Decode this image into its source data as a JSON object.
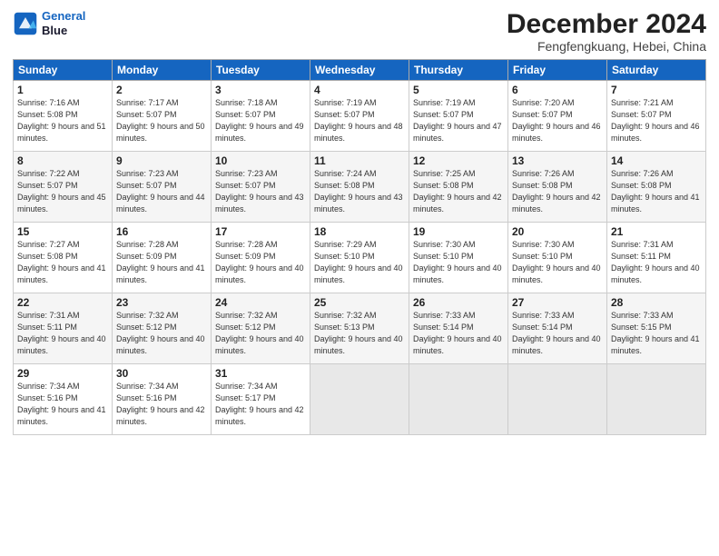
{
  "header": {
    "logo_line1": "General",
    "logo_line2": "Blue",
    "month": "December 2024",
    "location": "Fengfengkuang, Hebei, China"
  },
  "weekdays": [
    "Sunday",
    "Monday",
    "Tuesday",
    "Wednesday",
    "Thursday",
    "Friday",
    "Saturday"
  ],
  "weeks": [
    [
      {
        "day": "1",
        "info": "Sunrise: 7:16 AM\nSunset: 5:08 PM\nDaylight: 9 hours\nand 51 minutes."
      },
      {
        "day": "2",
        "info": "Sunrise: 7:17 AM\nSunset: 5:07 PM\nDaylight: 9 hours\nand 50 minutes."
      },
      {
        "day": "3",
        "info": "Sunrise: 7:18 AM\nSunset: 5:07 PM\nDaylight: 9 hours\nand 49 minutes."
      },
      {
        "day": "4",
        "info": "Sunrise: 7:19 AM\nSunset: 5:07 PM\nDaylight: 9 hours\nand 48 minutes."
      },
      {
        "day": "5",
        "info": "Sunrise: 7:19 AM\nSunset: 5:07 PM\nDaylight: 9 hours\nand 47 minutes."
      },
      {
        "day": "6",
        "info": "Sunrise: 7:20 AM\nSunset: 5:07 PM\nDaylight: 9 hours\nand 46 minutes."
      },
      {
        "day": "7",
        "info": "Sunrise: 7:21 AM\nSunset: 5:07 PM\nDaylight: 9 hours\nand 46 minutes."
      }
    ],
    [
      {
        "day": "8",
        "info": "Sunrise: 7:22 AM\nSunset: 5:07 PM\nDaylight: 9 hours\nand 45 minutes."
      },
      {
        "day": "9",
        "info": "Sunrise: 7:23 AM\nSunset: 5:07 PM\nDaylight: 9 hours\nand 44 minutes."
      },
      {
        "day": "10",
        "info": "Sunrise: 7:23 AM\nSunset: 5:07 PM\nDaylight: 9 hours\nand 43 minutes."
      },
      {
        "day": "11",
        "info": "Sunrise: 7:24 AM\nSunset: 5:08 PM\nDaylight: 9 hours\nand 43 minutes."
      },
      {
        "day": "12",
        "info": "Sunrise: 7:25 AM\nSunset: 5:08 PM\nDaylight: 9 hours\nand 42 minutes."
      },
      {
        "day": "13",
        "info": "Sunrise: 7:26 AM\nSunset: 5:08 PM\nDaylight: 9 hours\nand 42 minutes."
      },
      {
        "day": "14",
        "info": "Sunrise: 7:26 AM\nSunset: 5:08 PM\nDaylight: 9 hours\nand 41 minutes."
      }
    ],
    [
      {
        "day": "15",
        "info": "Sunrise: 7:27 AM\nSunset: 5:08 PM\nDaylight: 9 hours\nand 41 minutes."
      },
      {
        "day": "16",
        "info": "Sunrise: 7:28 AM\nSunset: 5:09 PM\nDaylight: 9 hours\nand 41 minutes."
      },
      {
        "day": "17",
        "info": "Sunrise: 7:28 AM\nSunset: 5:09 PM\nDaylight: 9 hours\nand 40 minutes."
      },
      {
        "day": "18",
        "info": "Sunrise: 7:29 AM\nSunset: 5:10 PM\nDaylight: 9 hours\nand 40 minutes."
      },
      {
        "day": "19",
        "info": "Sunrise: 7:30 AM\nSunset: 5:10 PM\nDaylight: 9 hours\nand 40 minutes."
      },
      {
        "day": "20",
        "info": "Sunrise: 7:30 AM\nSunset: 5:10 PM\nDaylight: 9 hours\nand 40 minutes."
      },
      {
        "day": "21",
        "info": "Sunrise: 7:31 AM\nSunset: 5:11 PM\nDaylight: 9 hours\nand 40 minutes."
      }
    ],
    [
      {
        "day": "22",
        "info": "Sunrise: 7:31 AM\nSunset: 5:11 PM\nDaylight: 9 hours\nand 40 minutes."
      },
      {
        "day": "23",
        "info": "Sunrise: 7:32 AM\nSunset: 5:12 PM\nDaylight: 9 hours\nand 40 minutes."
      },
      {
        "day": "24",
        "info": "Sunrise: 7:32 AM\nSunset: 5:12 PM\nDaylight: 9 hours\nand 40 minutes."
      },
      {
        "day": "25",
        "info": "Sunrise: 7:32 AM\nSunset: 5:13 PM\nDaylight: 9 hours\nand 40 minutes."
      },
      {
        "day": "26",
        "info": "Sunrise: 7:33 AM\nSunset: 5:14 PM\nDaylight: 9 hours\nand 40 minutes."
      },
      {
        "day": "27",
        "info": "Sunrise: 7:33 AM\nSunset: 5:14 PM\nDaylight: 9 hours\nand 40 minutes."
      },
      {
        "day": "28",
        "info": "Sunrise: 7:33 AM\nSunset: 5:15 PM\nDaylight: 9 hours\nand 41 minutes."
      }
    ],
    [
      {
        "day": "29",
        "info": "Sunrise: 7:34 AM\nSunset: 5:16 PM\nDaylight: 9 hours\nand 41 minutes."
      },
      {
        "day": "30",
        "info": "Sunrise: 7:34 AM\nSunset: 5:16 PM\nDaylight: 9 hours\nand 42 minutes."
      },
      {
        "day": "31",
        "info": "Sunrise: 7:34 AM\nSunset: 5:17 PM\nDaylight: 9 hours\nand 42 minutes."
      },
      {
        "day": "",
        "info": ""
      },
      {
        "day": "",
        "info": ""
      },
      {
        "day": "",
        "info": ""
      },
      {
        "day": "",
        "info": ""
      }
    ]
  ]
}
